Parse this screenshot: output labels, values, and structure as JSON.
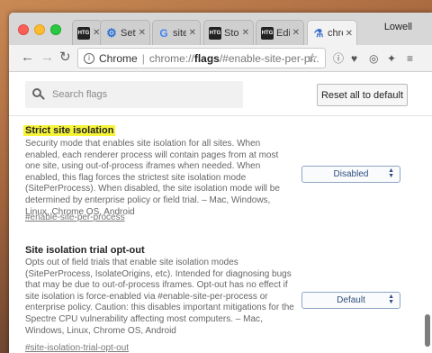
{
  "window": {
    "profile_name": "Lowell"
  },
  "tabs": [
    {
      "icon": "htg-icon",
      "favicon_text": "HTG",
      "label": "",
      "close": "✕"
    },
    {
      "icon": "settings-gear-icon",
      "favicon_text": "⚙",
      "label": "Setti",
      "close": "✕"
    },
    {
      "icon": "google-icon",
      "favicon_text": "G",
      "label": "site",
      "close": "✕"
    },
    {
      "icon": "htg-icon",
      "favicon_text": "HTG",
      "label": "Stop",
      "close": "✕"
    },
    {
      "icon": "htg-icon",
      "favicon_text": "HTG",
      "label": "Edit",
      "close": "✕"
    },
    {
      "icon": "flask-icon",
      "favicon_text": "⚗",
      "label": "chro",
      "close": "✕"
    }
  ],
  "toolbar": {
    "back": "←",
    "forward": "→",
    "reload": "↻",
    "omnibox": {
      "info_icon": "i",
      "scheme": "Chrome",
      "separator": "|",
      "url_prefix": "chrome://",
      "url_bold": "flags",
      "url_suffix": "/#enable-site-per-pr..."
    },
    "star": "☆",
    "extensions": [
      "ⓘ",
      "♥",
      "◎",
      "✦",
      "≡"
    ]
  },
  "search": {
    "placeholder": "Search flags"
  },
  "reset_button": {
    "label": "Reset all to default"
  },
  "flags": [
    {
      "title": "Strict site isolation",
      "highlighted": true,
      "description": "Security mode that enables site isolation for all sites. When enabled, each renderer process will contain pages from at most one site, using out-of-process iframes when needed. When enabled, this flag forces the strictest site isolation mode (SitePerProcess). When disabled, the site isolation mode will be determined by enterprise policy or field trial. – Mac, Windows, Linux, Chrome OS, Android",
      "link": "#enable-site-per-process",
      "selected_option": "Disabled"
    },
    {
      "title": "Site isolation trial opt-out",
      "highlighted": false,
      "description": "Opts out of field trials that enable site isolation modes (SitePerProcess, IsolateOrigins, etc). Intended for diagnosing bugs that may be due to out-of-process iframes. Opt-out has no effect if site isolation is force-enabled via #enable-site-per-process or enterprise policy. Caution: this disables important mitigations for the Spectre CPU vulnerability affecting most computers. – Mac, Windows, Linux, Chrome OS, Android",
      "link": "#site-isolation-trial-opt-out",
      "selected_option": "Default"
    }
  ],
  "colors": {
    "highlight": "#f6f53a",
    "select_border": "#8ea5c5",
    "select_text": "#2f4f7f"
  }
}
